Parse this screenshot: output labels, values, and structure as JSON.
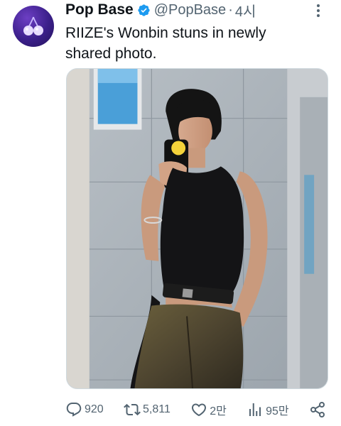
{
  "tweet": {
    "author": {
      "name": "Pop Base",
      "handle": "@PopBase",
      "separator": "·",
      "time": "4시",
      "avatar_icon": "cherry-icon",
      "verified_icon": "verified-badge-icon",
      "verified_color": "#1d9bf0"
    },
    "text_line1": "RIIZE's Wonbin stuns in newly",
    "text_line2": "shared photo.",
    "media": {
      "alt_kind": "mirror selfie photo"
    },
    "actions": {
      "reply_count": "920",
      "retweet_count": "5,811",
      "like_count": "2만",
      "views_count": "95만"
    }
  },
  "colors": {
    "text_primary": "#0f1419",
    "text_secondary": "#536471",
    "avatar_bg": "#3b1f8a"
  }
}
